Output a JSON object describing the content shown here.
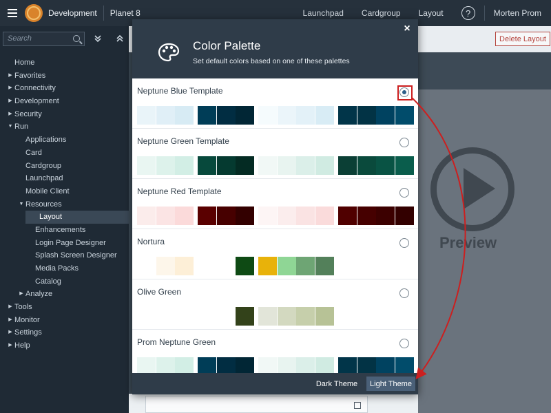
{
  "topbar": {
    "app_title": "Development",
    "system_name": "Planet 8",
    "links": [
      "Launchpad",
      "Cardgroup",
      "Layout"
    ],
    "help_glyph": "?",
    "user": "Morten Prom"
  },
  "sidebar": {
    "search_placeholder": "Search",
    "items": [
      {
        "label": "Home",
        "level": 0,
        "arrow": ""
      },
      {
        "label": "Favorites",
        "level": 0,
        "arrow": "right"
      },
      {
        "label": "Connectivity",
        "level": 0,
        "arrow": "right"
      },
      {
        "label": "Development",
        "level": 0,
        "arrow": "right"
      },
      {
        "label": "Security",
        "level": 0,
        "arrow": "right"
      },
      {
        "label": "Run",
        "level": 0,
        "arrow": "down"
      },
      {
        "label": "Applications",
        "level": 1,
        "arrow": ""
      },
      {
        "label": "Card",
        "level": 1,
        "arrow": ""
      },
      {
        "label": "Cardgroup",
        "level": 1,
        "arrow": ""
      },
      {
        "label": "Launchpad",
        "level": 1,
        "arrow": ""
      },
      {
        "label": "Mobile Client",
        "level": 1,
        "arrow": ""
      },
      {
        "label": "Resources",
        "level": 1,
        "arrow": "down"
      },
      {
        "label": "Layout",
        "level": 2,
        "arrow": "",
        "selected": true
      },
      {
        "label": "Enhancements",
        "level": 2,
        "arrow": ""
      },
      {
        "label": "Login Page Designer",
        "level": 2,
        "arrow": ""
      },
      {
        "label": "Splash Screen Designer",
        "level": 2,
        "arrow": ""
      },
      {
        "label": "Media Packs",
        "level": 2,
        "arrow": ""
      },
      {
        "label": "Catalog",
        "level": 2,
        "arrow": ""
      },
      {
        "label": "Analyze",
        "level": 1,
        "arrow": "right"
      },
      {
        "label": "Tools",
        "level": 0,
        "arrow": "right"
      },
      {
        "label": "Monitor",
        "level": 0,
        "arrow": "right"
      },
      {
        "label": "Settings",
        "level": 0,
        "arrow": "right"
      },
      {
        "label": "Help",
        "level": 0,
        "arrow": "right"
      }
    ]
  },
  "main": {
    "delete_button": "Delete Layout",
    "preview_label": "Preview"
  },
  "modal": {
    "title": "Color Palette",
    "subtitle": "Set default colors based on one of these palettes",
    "close_glyph": "×",
    "footer": {
      "dark": "Dark Theme",
      "light": "Light Theme",
      "active": "light"
    },
    "palettes": [
      {
        "name": "Neptune Blue Template",
        "selected": true,
        "light": [
          "#e9f4f9",
          "#e0eff7",
          "#d7ebf4"
        ],
        "dark": [
          "#003d57",
          "#012d42",
          "#012635"
        ],
        "light2": [
          "#f5fbfd",
          "#ebf5fa",
          "#e3f1f8",
          "#d8ecf5"
        ],
        "dark2": [
          "#013549",
          "#023345",
          "#004260",
          "#014c6b"
        ]
      },
      {
        "name": "Neptune Green Template",
        "selected": false,
        "light": [
          "#e9f6f2",
          "#ddf2eb",
          "#d2eee5"
        ],
        "dark": [
          "#07493c",
          "#053a30",
          "#042b23"
        ],
        "light2": [
          "#f1f8f6",
          "#e8f4f0",
          "#dbefe9",
          "#d0ebe2"
        ],
        "dark2": [
          "#0b3f35",
          "#0a4a3c",
          "#095344",
          "#0a5d4c"
        ]
      },
      {
        "name": "Neptune Red Template",
        "selected": false,
        "light": [
          "#fbeceb",
          "#fbe4e4",
          "#fbdada"
        ],
        "dark": [
          "#5a0000",
          "#470000",
          "#330000"
        ],
        "light2": [
          "#fdf5f5",
          "#fbeded",
          "#fae3e3",
          "#fadbdb"
        ],
        "dark2": [
          "#500000",
          "#460000",
          "#3c0000",
          "#330000"
        ]
      },
      {
        "name": "Nortura",
        "selected": false,
        "light": [
          "#ffffff",
          "#fdf6ea",
          "#fdefd7"
        ],
        "dark": [
          "#ffffff",
          "#ffffff",
          "#0e4a14"
        ],
        "light2": [
          "#e8b20a",
          "#8fd695",
          "#6ea574",
          "#53805a"
        ],
        "dark2": []
      },
      {
        "name": "Olive Green",
        "selected": false,
        "light": [],
        "dark": [
          "#ffffff",
          "#ffffff",
          "#33421a"
        ],
        "light2": [
          "#e2e5d9",
          "#d3d9c0",
          "#c6cfab",
          "#b7c296"
        ],
        "dark2": []
      },
      {
        "name": "Prom Neptune Green",
        "selected": false,
        "light": [
          "#e9f6f2",
          "#ddf2eb",
          "#d2eee5"
        ],
        "dark": [
          "#003d57",
          "#012d42",
          "#012635"
        ],
        "light2": [
          "#f1f8f6",
          "#e8f4f0",
          "#dbefe9",
          "#d0ebe2"
        ],
        "dark2": [
          "#013549",
          "#023345",
          "#004260",
          "#014c6b"
        ]
      }
    ]
  },
  "colors": {
    "annotation": "#cc1f1f",
    "brand_logo": "#d9832b",
    "delete": "#b5443e"
  }
}
